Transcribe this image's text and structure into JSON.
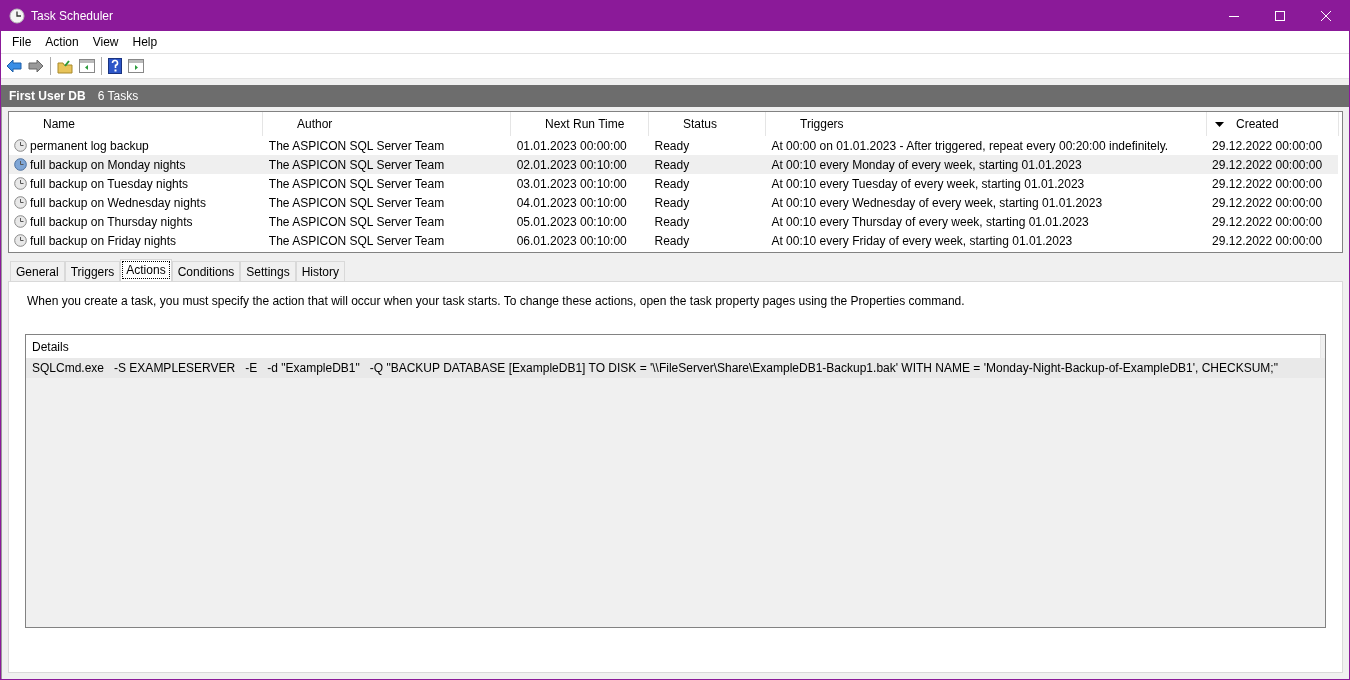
{
  "window": {
    "title": "Task Scheduler"
  },
  "menu": [
    "File",
    "Action",
    "View",
    "Help"
  ],
  "header": {
    "title": "First User DB",
    "count": "6 Tasks"
  },
  "table": {
    "columns": [
      {
        "label": "Name",
        "sorted": false
      },
      {
        "label": "Author",
        "sorted": false
      },
      {
        "label": "Next Run Time",
        "sorted": false
      },
      {
        "label": "Status",
        "sorted": false
      },
      {
        "label": "Triggers",
        "sorted": false
      },
      {
        "label": "Created",
        "sorted": true
      }
    ],
    "rows": [
      {
        "selected": false,
        "cells": [
          "permanent log backup",
          "The ASPICON SQL Server Team",
          "01.01.2023 00:00:00",
          "Ready",
          "At 00:00 on 01.01.2023 - After triggered, repeat every 00:20:00 indefinitely.",
          "29.12.2022 00:00:00"
        ]
      },
      {
        "selected": true,
        "cells": [
          "full backup on Monday nights",
          "The ASPICON SQL Server Team",
          "02.01.2023 00:10:00",
          "Ready",
          "At 00:10 every Monday of every week, starting 01.01.2023",
          "29.12.2022 00:00:00"
        ]
      },
      {
        "selected": false,
        "cells": [
          "full backup on Tuesday nights",
          "The ASPICON SQL Server Team",
          "03.01.2023 00:10:00",
          "Ready",
          "At 00:10 every Tuesday of every week, starting 01.01.2023",
          "29.12.2022 00:00:00"
        ]
      },
      {
        "selected": false,
        "cells": [
          "full backup on Wednesday nights",
          "The ASPICON SQL Server Team",
          "04.01.2023 00:10:00",
          "Ready",
          "At 00:10 every Wednesday of every week, starting 01.01.2023",
          "29.12.2022 00:00:00"
        ]
      },
      {
        "selected": false,
        "cells": [
          "full backup on Thursday nights",
          "The ASPICON SQL Server Team",
          "05.01.2023 00:10:00",
          "Ready",
          "At 00:10 every Thursday of every week, starting 01.01.2023",
          "29.12.2022 00:00:00"
        ]
      },
      {
        "selected": false,
        "cells": [
          "full backup on Friday nights",
          "The ASPICON SQL Server Team",
          "06.01.2023 00:10:00",
          "Ready",
          "At 00:10 every Friday of every week, starting 01.01.2023",
          "29.12.2022 00:00:00"
        ]
      }
    ]
  },
  "tabs": [
    {
      "label": "General",
      "selected": false
    },
    {
      "label": "Triggers",
      "selected": false
    },
    {
      "label": "Actions",
      "selected": true
    },
    {
      "label": "Conditions",
      "selected": false
    },
    {
      "label": "Settings",
      "selected": false
    },
    {
      "label": "History",
      "selected": false
    }
  ],
  "actions_page": {
    "description": "When you create a task, you must specify the action that will occur when your task starts.  To change these actions, open the task property pages using the Properties command.",
    "details": {
      "column": "Details",
      "rows": [
        "SQLCmd.exe   -S EXAMPLESERVER   -E   -d \"ExampleDB1\"   -Q \"BACKUP DATABASE [ExampleDB1] TO DISK = '\\\\FileServer\\Share\\ExampleDB1-Backup1.bak' WITH NAME = 'Monday-Night-Backup-of-ExampleDB1', CHECKSUM;\""
      ]
    }
  }
}
